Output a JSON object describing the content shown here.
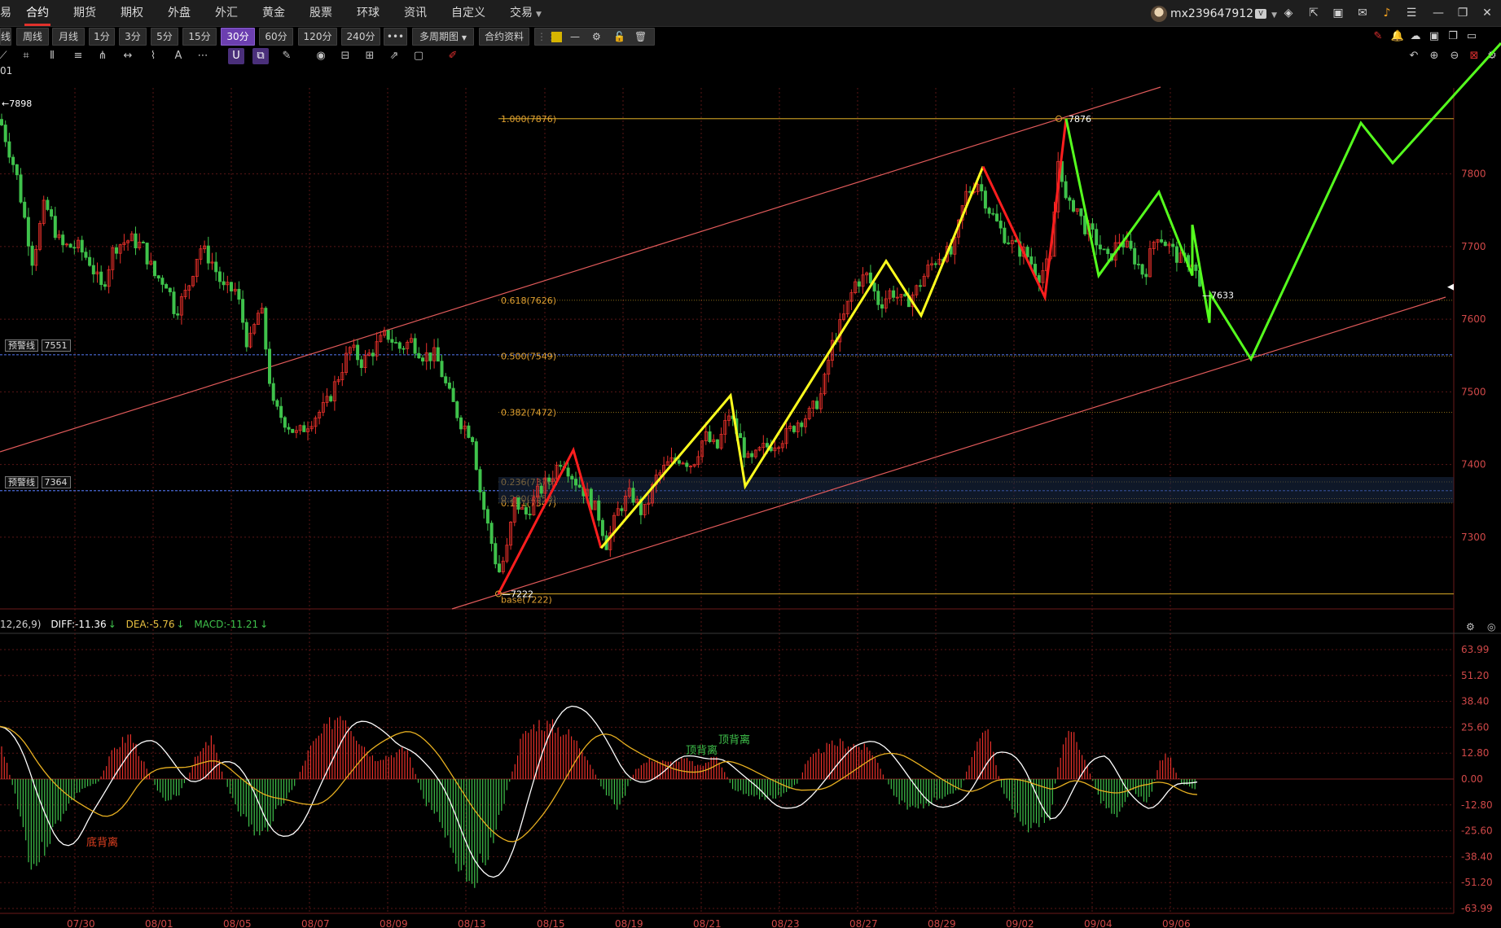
{
  "menu": {
    "items": [
      {
        "label": "合约",
        "active": true
      },
      {
        "label": "期货"
      },
      {
        "label": "期权"
      },
      {
        "label": "外盘"
      },
      {
        "label": "外汇"
      },
      {
        "label": "黄金"
      },
      {
        "label": "股票"
      },
      {
        "label": "环球"
      },
      {
        "label": "资讯"
      },
      {
        "label": "自定义"
      },
      {
        "label": "交易"
      }
    ],
    "partial_left": "易",
    "username": "mx239647912"
  },
  "toolbar": {
    "partial_left": "线",
    "periods": [
      "周线",
      "月线",
      "1分",
      "3分",
      "5分",
      "15分",
      "30分",
      "60分",
      "120分",
      "240分"
    ],
    "selected_period": "30分",
    "more": "•••",
    "multi_period": "多周期图",
    "contract_info": "合约资料"
  },
  "symbol_code": "01",
  "price_axis": {
    "labels": [
      "7800",
      "7700",
      "7600",
      "7500",
      "7400",
      "7300"
    ]
  },
  "date_axis": {
    "labels": [
      "07/30",
      "08/01",
      "08/05",
      "08/07",
      "08/09",
      "08/13",
      "08/15",
      "08/19",
      "08/21",
      "08/23",
      "08/27",
      "08/29",
      "09/02",
      "09/04",
      "09/06"
    ]
  },
  "markers": {
    "high_left": "←7898",
    "high_point": "7876",
    "low_point": "7222",
    "last_price": "7633"
  },
  "alerts": [
    {
      "label": "预警线",
      "value": "7551"
    },
    {
      "label": "预警线",
      "value": "7364"
    }
  ],
  "fib": {
    "levels": [
      {
        "label": "1.000(7876)",
        "price": 7876
      },
      {
        "label": "0.618(7626)",
        "price": 7626
      },
      {
        "label": "0.500(7549)",
        "price": 7549
      },
      {
        "label": "0.382(7472)",
        "price": 7472
      },
      {
        "label": "0.236(7376)",
        "price": 7376
      },
      {
        "label": "0.200(7353)",
        "price": 7353
      },
      {
        "label": "0.191(7347)",
        "price": 7347
      },
      {
        "label": "base(7222)",
        "price": 7222
      }
    ]
  },
  "macd": {
    "params": "12,26,9)",
    "diff": "DIFF:-11.36",
    "dea": "DEA:-5.76",
    "macd": "MACD:-11.21",
    "axis_labels": [
      "63.99",
      "51.20",
      "38.40",
      "25.60",
      "12.80",
      "0.00",
      "-12.80",
      "-25.60",
      "-38.40",
      "-51.20",
      "-63.99"
    ],
    "annotation_divergence_bottom": "底背离",
    "annotation_divergence_top": "顶背离"
  },
  "colors": {
    "up": "#e8302a",
    "down": "#3fc24b",
    "grid": "#5a1616",
    "axis_text": "#d04848",
    "zigzag_red": "#ff1e1e",
    "zigzag_yellow": "#ffff1e",
    "zigzag_green": "#55ff1e",
    "channel": "#e05a5a",
    "alert_line": "#4a6ad8",
    "fib": "#b89020",
    "menu_active": "#e0312b",
    "period_selected": "#6c3fb0"
  },
  "chart_data": {
    "type": "candlestick",
    "instrument_period": "30分",
    "y_main_range": [
      7222,
      7898
    ],
    "x_dates": [
      "07/30",
      "08/01",
      "08/05",
      "08/07",
      "08/09",
      "08/13",
      "08/15",
      "08/19",
      "08/21",
      "08/23",
      "08/27",
      "08/29",
      "09/02",
      "09/04",
      "09/06"
    ],
    "zigzag_red": [
      {
        "date": "08/14",
        "price": 7222
      },
      {
        "date": "08/16",
        "price": 7420
      },
      {
        "date": "08/19",
        "price": 7285
      }
    ],
    "zigzag_yellow_1": [
      {
        "date": "08/19",
        "price": 7285
      },
      {
        "date": "08/22",
        "price": 7495
      },
      {
        "date": "08/22",
        "price": 7370
      },
      {
        "date": "08/26",
        "price": 7680
      },
      {
        "date": "08/28",
        "price": 7605
      },
      {
        "date": "08/30",
        "price": 7810
      }
    ],
    "zigzag_red_2": [
      {
        "date": "08/30",
        "price": 7810
      },
      {
        "date": "09/02",
        "price": 7630
      },
      {
        "date": "09/03",
        "price": 7876
      }
    ],
    "zigzag_green": [
      {
        "date": "09/03",
        "price": 7876
      },
      {
        "date": "09/04",
        "price": 7660
      },
      {
        "date": "09/05",
        "price": 7775
      },
      {
        "date": "09/06",
        "price": 7660
      },
      {
        "date": "09/06",
        "price": 7730
      },
      {
        "date": "09/09",
        "price": 7595
      },
      {
        "date": "09/09",
        "price": 7635
      },
      {
        "date": "09/10",
        "price": 7545
      },
      {
        "date": "09/13",
        "price": 7870
      },
      {
        "date": "09/16",
        "price": 7815
      },
      {
        "date": "09/17",
        "price": 7980
      }
    ],
    "macd": {
      "diff": -11.36,
      "dea": -5.76,
      "macd": -11.21,
      "ylim": [
        -63.99,
        63.99
      ]
    }
  }
}
